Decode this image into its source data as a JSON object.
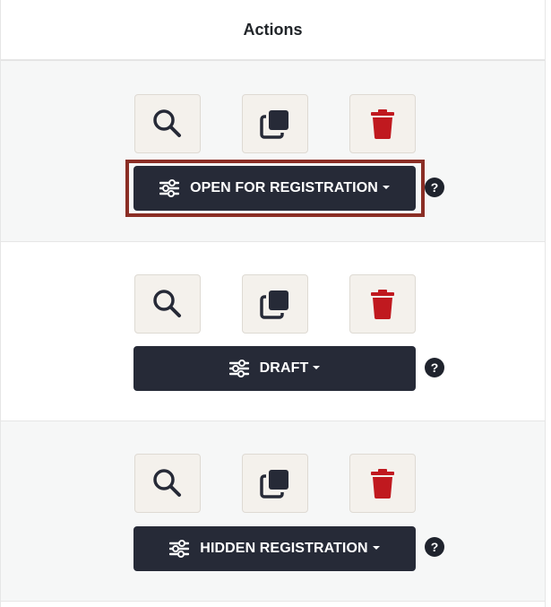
{
  "table": {
    "header": {
      "actions_label": "Actions"
    }
  },
  "rows": [
    {
      "status_label": "OPEN FOR REGISTRATION",
      "highlighted": true,
      "help_label": "?"
    },
    {
      "status_label": "DRAFT",
      "highlighted": false,
      "help_label": "?"
    },
    {
      "status_label": "HIDDEN REGISTRATION",
      "highlighted": false,
      "help_label": "?"
    }
  ],
  "icons": {
    "view": "search-icon",
    "copy": "copy-icon",
    "delete": "trash-icon",
    "status": "sliders-icon",
    "dropdown": "caret-down-icon",
    "help": "question-circle-icon"
  },
  "colors": {
    "status_button_bg": "#262a37",
    "icon_button_bg": "#f4f1ec",
    "delete_icon": "#c0191f",
    "icon_dark": "#262a37",
    "highlight_border": "#8b2e25",
    "striped_row_bg": "#f6f7f7"
  }
}
